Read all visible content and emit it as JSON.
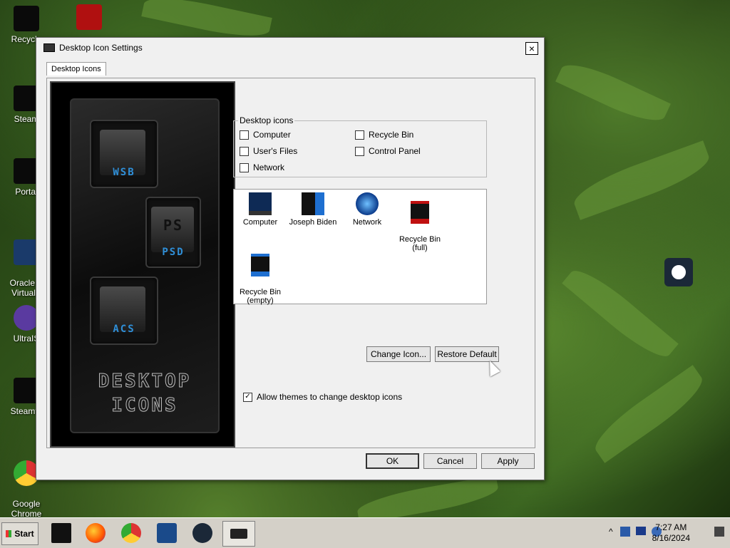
{
  "window": {
    "title": "Desktop Icon Settings",
    "close_glyph": "×",
    "tab": "Desktop Icons"
  },
  "preview": {
    "tiles": [
      "WSB",
      "PS",
      "ACS"
    ],
    "tile_sub": "PSD",
    "title_line1": "DESKTOP",
    "title_line2": "ICONS"
  },
  "desktop_icons_group": {
    "legend": "Desktop icons",
    "items": [
      {
        "label": "Computer",
        "checked": false
      },
      {
        "label": "Recycle Bin",
        "checked": false
      },
      {
        "label": "User's Files",
        "checked": false
      },
      {
        "label": "Control Panel",
        "checked": false
      },
      {
        "label": "Network",
        "checked": false
      }
    ]
  },
  "icon_list": [
    {
      "label": "Computer",
      "icon": "monitor-icon"
    },
    {
      "label": "Joseph Biden",
      "icon": "user-folder-icon"
    },
    {
      "label": "Network",
      "icon": "globe-icon"
    },
    {
      "label": "Recycle Bin\n(full)",
      "icon": "recycle-bin-full-icon"
    },
    {
      "label": "Recycle Bin\n(empty)",
      "icon": "recycle-bin-empty-icon"
    }
  ],
  "buttons": {
    "change_icon": "Change Icon...",
    "restore_default": "Restore Default",
    "ok": "OK",
    "cancel": "Cancel",
    "apply": "Apply"
  },
  "allow_themes": {
    "label": "Allow themes to change desktop icons",
    "checked": true
  },
  "desktop": [
    {
      "label": "Recycle",
      "icon": "recycle-bin-icon"
    },
    {
      "label": "Steam",
      "icon": "steam-icon"
    },
    {
      "label": "Portal",
      "icon": "portal-icon"
    },
    {
      "label": "Oracle V\nVirtualB",
      "icon": "virtualbox-icon"
    },
    {
      "label": "UltraIS",
      "icon": "ultraiso-icon"
    },
    {
      "label": "Steamto",
      "icon": "steam-tool-icon"
    },
    {
      "label": "Google\nChrome",
      "icon": "chrome-icon"
    }
  ],
  "taskbar": {
    "start": "Start",
    "apps": [
      "terminal-icon",
      "firefox-icon",
      "chrome-icon",
      "virtualbox-icon",
      "steam-icon",
      "desktop-settings-icon"
    ],
    "tray_expand": "^",
    "time": "7:27 AM",
    "date": "8/16/2024"
  }
}
